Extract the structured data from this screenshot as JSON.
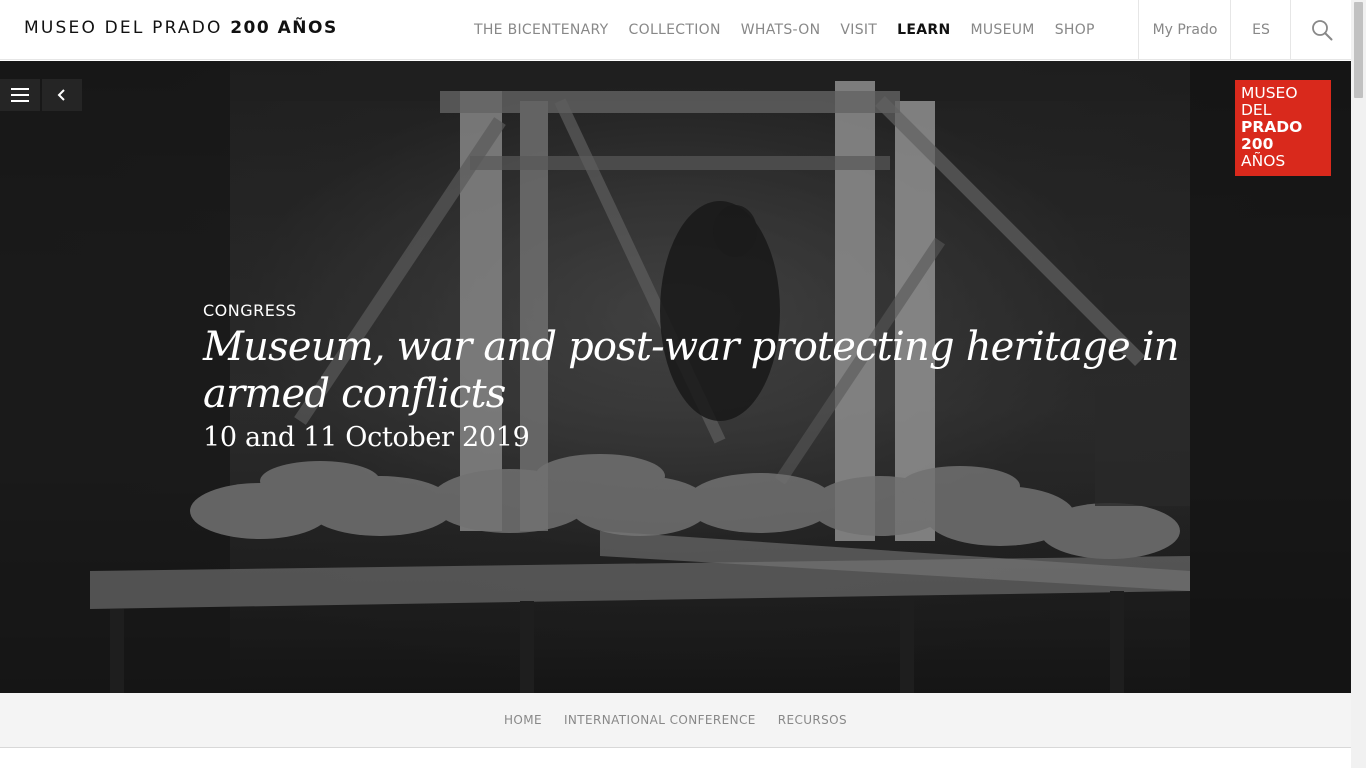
{
  "header": {
    "logo_text": "MUSEO DEL PRADO",
    "logo_bold": "200 AÑOS",
    "nav": [
      {
        "label": "THE BICENTENARY"
      },
      {
        "label": "COLLECTION"
      },
      {
        "label": "WHATS-ON"
      },
      {
        "label": "VISIT"
      },
      {
        "label": "LEARN",
        "active": true
      },
      {
        "label": "MUSEUM"
      },
      {
        "label": "SHOP"
      }
    ],
    "my_prado": "My Prado",
    "language": "ES",
    "search_icon": "search-icon"
  },
  "sidebar": {
    "menu_icon": "hamburger-menu-icon",
    "back_icon": "chevron-left-icon"
  },
  "badge": {
    "line1": "MUSEO",
    "line2": "DEL",
    "line3": "PRADO",
    "line4": "200",
    "line5": "AÑOS",
    "color": "#d9291c"
  },
  "hero": {
    "eyebrow": "CONGRESS",
    "title": "Museum, war and post-war protecting heritage in armed conflicts",
    "dates": "10 and 11 October 2019"
  },
  "breadcrumbs": [
    {
      "label": "HOME"
    },
    {
      "label": "INTERNATIONAL CONFERENCE"
    },
    {
      "label": "RECURSOS"
    }
  ]
}
